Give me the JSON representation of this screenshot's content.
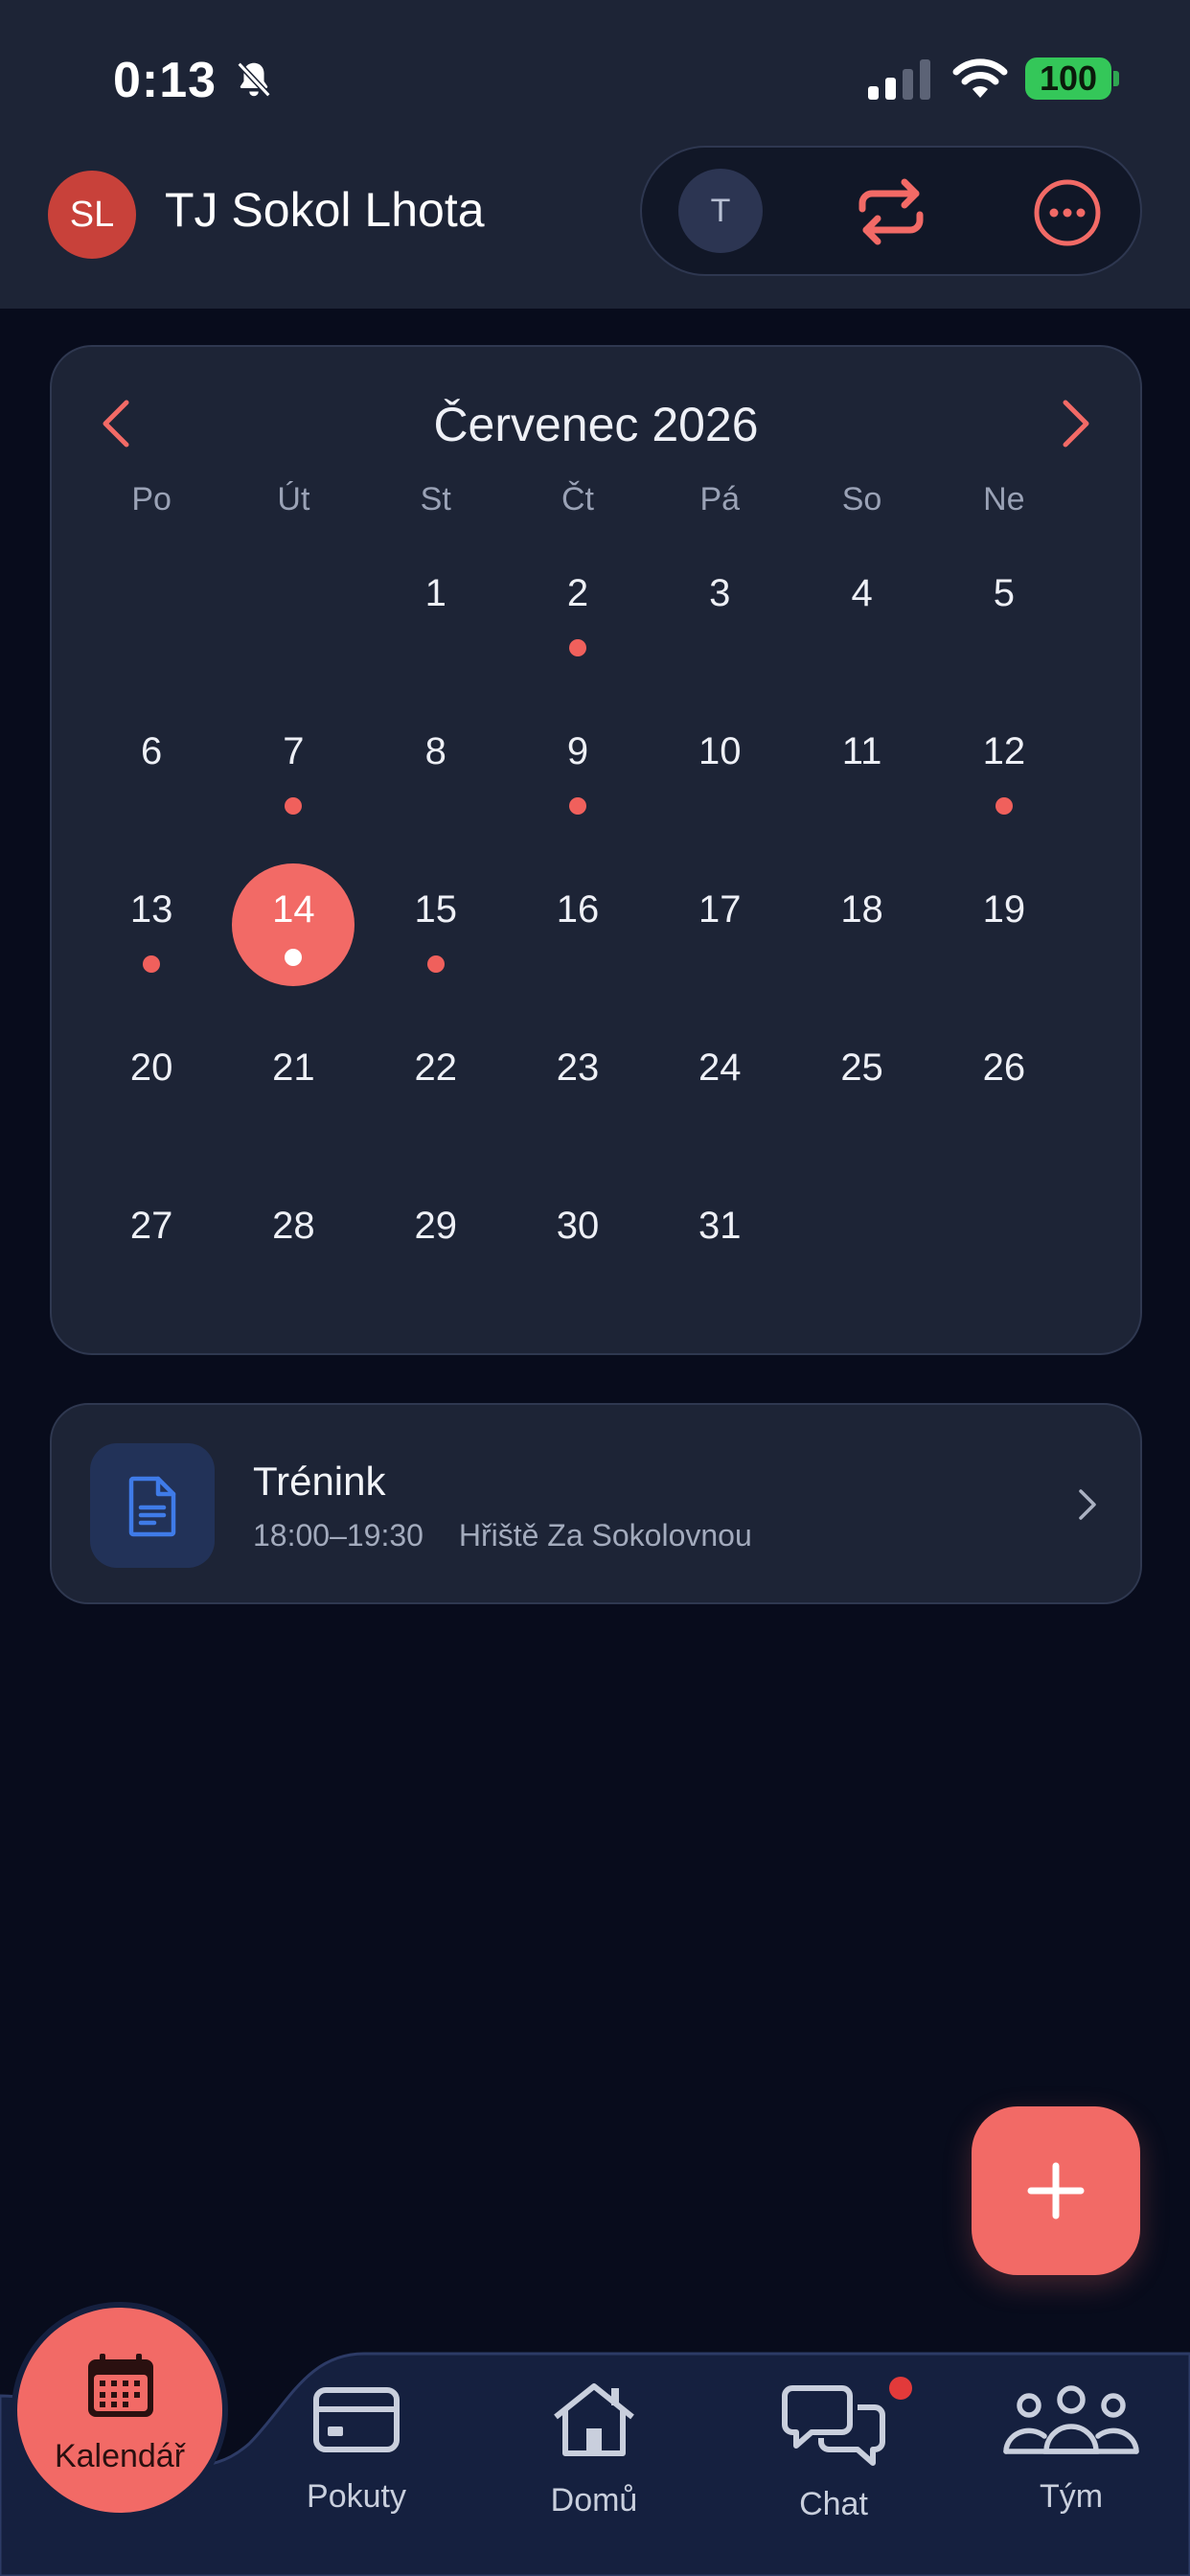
{
  "status_bar": {
    "time": "0:13",
    "battery": "100"
  },
  "header": {
    "team_initials": "SL",
    "team_name": "TJ Sokol Lhota",
    "user_initial": "T"
  },
  "calendar": {
    "month_title": "Červenec 2026",
    "weekdays": [
      "Po",
      "Út",
      "St",
      "Čt",
      "Pá",
      "So",
      "Ne"
    ],
    "leading_blank_days": 2,
    "days": [
      {
        "n": "1",
        "dot": false
      },
      {
        "n": "2",
        "dot": true
      },
      {
        "n": "3",
        "dot": false
      },
      {
        "n": "4",
        "dot": false
      },
      {
        "n": "5",
        "dot": false
      },
      {
        "n": "6",
        "dot": false
      },
      {
        "n": "7",
        "dot": true
      },
      {
        "n": "8",
        "dot": false
      },
      {
        "n": "9",
        "dot": true
      },
      {
        "n": "10",
        "dot": false
      },
      {
        "n": "11",
        "dot": false
      },
      {
        "n": "12",
        "dot": true
      },
      {
        "n": "13",
        "dot": true
      },
      {
        "n": "14",
        "dot": true,
        "selected": true
      },
      {
        "n": "15",
        "dot": true
      },
      {
        "n": "16",
        "dot": false
      },
      {
        "n": "17",
        "dot": false
      },
      {
        "n": "18",
        "dot": false
      },
      {
        "n": "19",
        "dot": false
      },
      {
        "n": "20",
        "dot": false
      },
      {
        "n": "21",
        "dot": false
      },
      {
        "n": "22",
        "dot": false
      },
      {
        "n": "23",
        "dot": false
      },
      {
        "n": "24",
        "dot": false
      },
      {
        "n": "25",
        "dot": false
      },
      {
        "n": "26",
        "dot": false
      },
      {
        "n": "27",
        "dot": false
      },
      {
        "n": "28",
        "dot": false
      },
      {
        "n": "29",
        "dot": false
      },
      {
        "n": "30",
        "dot": false
      },
      {
        "n": "31",
        "dot": false
      }
    ]
  },
  "event": {
    "title": "Trénink",
    "time": "18:00–19:30",
    "location": "Hřiště Za Sokolovnou"
  },
  "nav": {
    "calendar": "Kalendář",
    "fines": "Pokuty",
    "home": "Domů",
    "chat": "Chat",
    "team": "Tým"
  },
  "colors": {
    "accent": "#f26a66",
    "background": "#080c1c",
    "surface": "#1d2436",
    "event_dot": "#f0605c",
    "battery": "#34c759"
  }
}
